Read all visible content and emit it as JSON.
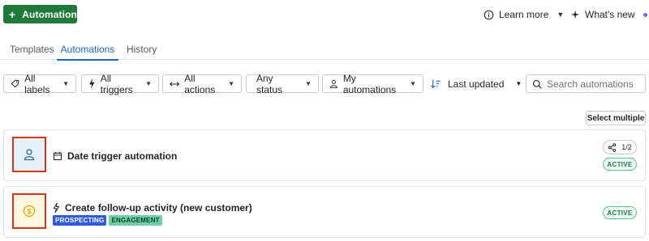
{
  "header": {
    "primary_button": "Automation",
    "learn_more": "Learn more",
    "whats_new": "What's new"
  },
  "tabs": [
    {
      "label": "Templates"
    },
    {
      "label": "Automations",
      "active": true
    },
    {
      "label": "History"
    }
  ],
  "filters": {
    "labels": "All labels",
    "triggers": "All triggers",
    "actions": "All actions",
    "status": "Any status",
    "owner": "My automations",
    "sort": "Last updated",
    "search_placeholder": "Search automations"
  },
  "select_multiple": "Select multiple",
  "automations": [
    {
      "title": "Date trigger automation",
      "trigger_icon": "calendar-icon",
      "type_icon": "person-icon",
      "share_count": "1/2",
      "status": "ACTIVE",
      "tags": []
    },
    {
      "title": "Create follow-up activity (new customer)",
      "trigger_icon": "bolt-icon",
      "type_icon": "dollar-coin-icon",
      "status": "ACTIVE",
      "tags": [
        "PROSPECTING",
        "ENGAGEMENT"
      ]
    }
  ],
  "colors": {
    "primary_green": "#1f7a3a",
    "tab_active": "#1f63c6",
    "highlight_border": "#d9331f",
    "active_status": "#1c7a43",
    "tag_prospecting": "#2f5bd7",
    "tag_engagement": "#6fd0a6"
  }
}
